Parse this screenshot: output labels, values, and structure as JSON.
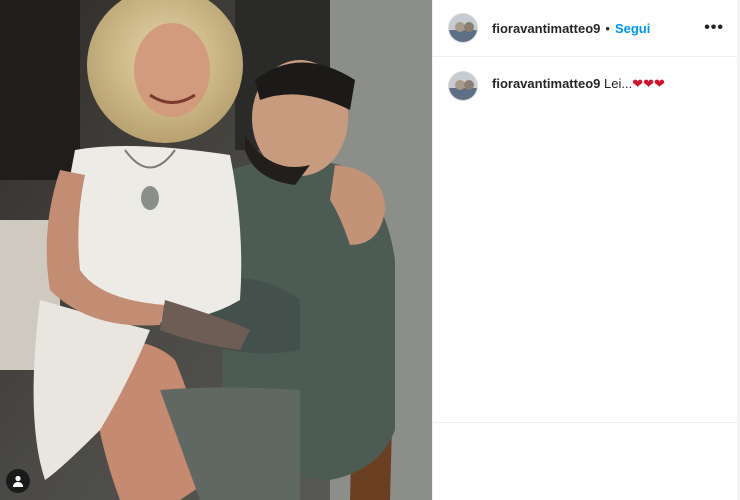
{
  "post": {
    "username": "fioravantimatteo9",
    "separator": "•",
    "follow_label": "Segui",
    "more_label": "•••"
  },
  "comment": {
    "username": "fioravantimatteo9",
    "text": "Lei...",
    "emoji": "❤❤❤"
  },
  "colors": {
    "follow": "#0095f6",
    "heart": "#d1132a"
  },
  "icons": {
    "tag": "user-tag-icon",
    "more": "more-options-icon"
  }
}
